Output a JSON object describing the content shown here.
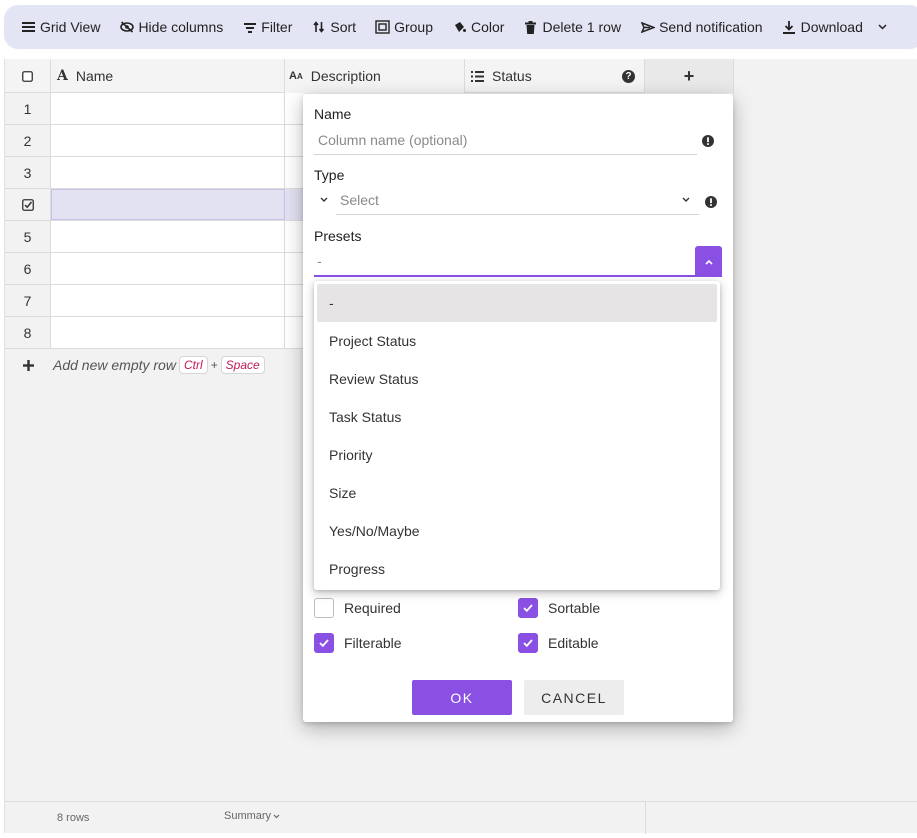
{
  "toolbar": {
    "items": [
      {
        "label": "Grid View",
        "icon": "menu-icon"
      },
      {
        "label": "Hide columns",
        "icon": "eye-slash-icon"
      },
      {
        "label": "Filter",
        "icon": "filter-icon"
      },
      {
        "label": "Sort",
        "icon": "sort-icon"
      },
      {
        "label": "Group",
        "icon": "group-icon"
      },
      {
        "label": "Color",
        "icon": "palette-icon"
      },
      {
        "label": "Delete 1 row",
        "icon": "trash-icon"
      },
      {
        "label": "Send notification",
        "icon": "send-icon"
      },
      {
        "label": "Download",
        "icon": "download-icon"
      }
    ]
  },
  "grid": {
    "columns": [
      {
        "label": "Name",
        "icon": "text-icon"
      },
      {
        "label": "Description",
        "icon": "text-size-icon"
      },
      {
        "label": "Status",
        "icon": "list-icon"
      }
    ],
    "add_column": "+",
    "rows": [
      "1",
      "2",
      "3",
      "",
      "5",
      "6",
      "7",
      "8"
    ],
    "add_row_label": "Add new empty row",
    "add_row_key1": "Ctrl",
    "add_row_plus": "+",
    "add_row_key2": "Space",
    "footer_rows": "8 rows",
    "footer_summary": "Summary"
  },
  "dialog": {
    "name_label": "Name",
    "name_placeholder": "Column name (optional)",
    "type_label": "Type",
    "type_placeholder": "Select",
    "presets_label": "Presets",
    "presets_value": "-",
    "preset_options": [
      "-",
      "Project Status",
      "Review Status",
      "Task Status",
      "Priority",
      "Size",
      "Yes/No/Maybe",
      "Progress"
    ],
    "checkboxes": [
      {
        "label": "Required",
        "checked": false
      },
      {
        "label": "Sortable",
        "checked": true
      },
      {
        "label": "Filterable",
        "checked": true
      },
      {
        "label": "Editable",
        "checked": true
      }
    ],
    "ok_label": "OK",
    "cancel_label": "CANCEL"
  },
  "colors": {
    "accent": "#8a4fe3",
    "toolbar_bg": "#e3e5f5",
    "selected_row": "#e3e2f3"
  }
}
